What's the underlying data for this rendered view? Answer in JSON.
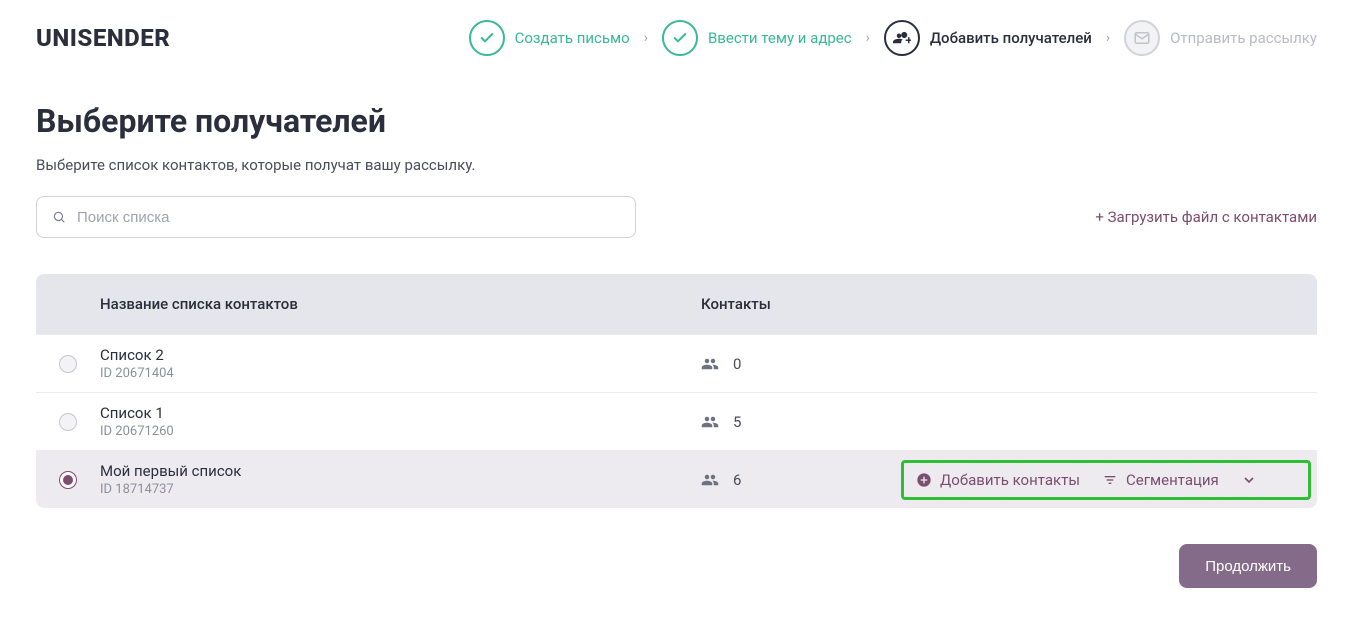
{
  "brand": "UNISENDER",
  "steps": [
    {
      "label": "Создать письмо",
      "state": "done"
    },
    {
      "label": "Ввести тему и адрес",
      "state": "done"
    },
    {
      "label": "Добавить получателей",
      "state": "active"
    },
    {
      "label": "Отправить рассылку",
      "state": "inactive"
    }
  ],
  "page": {
    "title": "Выберите получателей",
    "subtitle": "Выберите список контактов, которые получат вашу рассылку."
  },
  "search": {
    "placeholder": "Поиск списка"
  },
  "upload_link": "+ Загрузить файл с контактами",
  "table": {
    "headers": {
      "name": "Название списка контактов",
      "contacts": "Контакты"
    },
    "rows": [
      {
        "name": "Список 2",
        "id": "ID 20671404",
        "contacts": "0",
        "selected": false
      },
      {
        "name": "Список 1",
        "id": "ID 20671260",
        "contacts": "5",
        "selected": false
      },
      {
        "name": "Мой первый список",
        "id": "ID 18714737",
        "contacts": "6",
        "selected": true
      }
    ]
  },
  "row_actions": {
    "add_contacts": "Добавить контакты",
    "segmentation": "Сегментация"
  },
  "continue_label": "Продолжить"
}
